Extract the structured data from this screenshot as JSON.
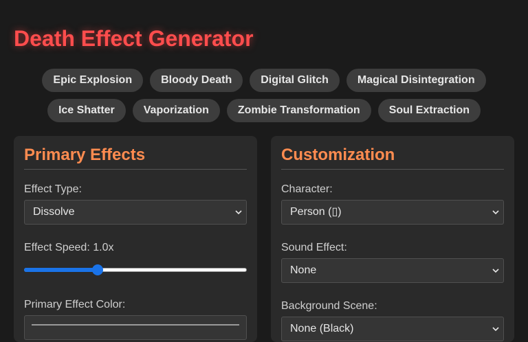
{
  "title": "Death Effect Generator",
  "presets": {
    "row1": [
      "Epic Explosion",
      "Bloody Death",
      "Digital Glitch",
      "Magical Disintegration"
    ],
    "row2": [
      "Ice Shatter",
      "Vaporization",
      "Zombie Transformation",
      "Soul Extraction"
    ]
  },
  "primary": {
    "title": "Primary Effects",
    "effect_type_label": "Effect Type:",
    "effect_type_value": "Dissolve",
    "speed_label": "Effect Speed: 1.0x",
    "speed_fraction": 0.33,
    "color_label": "Primary Effect Color:"
  },
  "custom": {
    "title": "Customization",
    "character_label": "Character:",
    "character_value": "Person (▯)",
    "sound_label": "Sound Effect:",
    "sound_value": "None",
    "background_label": "Background Scene:",
    "background_value": "None (Black)"
  },
  "colors": {
    "title": "#ff4d4d",
    "panel_title": "#ff8c50",
    "slider_accent": "#1a73e8"
  }
}
